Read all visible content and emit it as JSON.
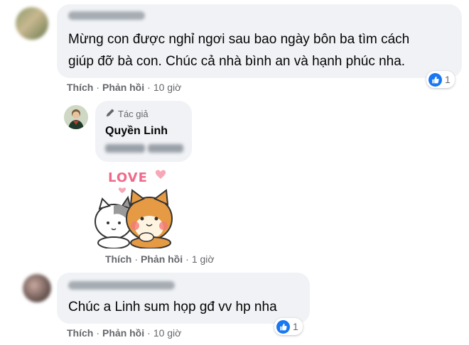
{
  "comment1": {
    "text_line1": "Mừng con được nghỉ ngơi sau bao ngày bôn ba tìm cách",
    "text_line2": "giúp đỡ bà con. Chúc cả nhà bình an và hạnh phúc nha.",
    "like_action": "Thích",
    "reply_action": "Phản hồi",
    "time": "10 giờ",
    "reaction_count": "1",
    "reaction_icon": "like-icon"
  },
  "reply": {
    "badge_label": "Tác giả",
    "badge_icon": "pencil-icon",
    "author": "Quyền Linh",
    "sticker_text": "LOVE",
    "like_action": "Thích",
    "reply_action": "Phản hồi",
    "time": "1 giờ"
  },
  "comment2": {
    "text": "Chúc a Linh sum họp gđ vv hp nha",
    "like_action": "Thích",
    "reply_action": "Phản hồi",
    "time": "10 giờ",
    "reaction_count": "1",
    "reaction_icon": "like-icon"
  },
  "colors": {
    "bubble": "#f0f2f5",
    "action_text": "#65676b",
    "like_blue": "#1877f2"
  }
}
